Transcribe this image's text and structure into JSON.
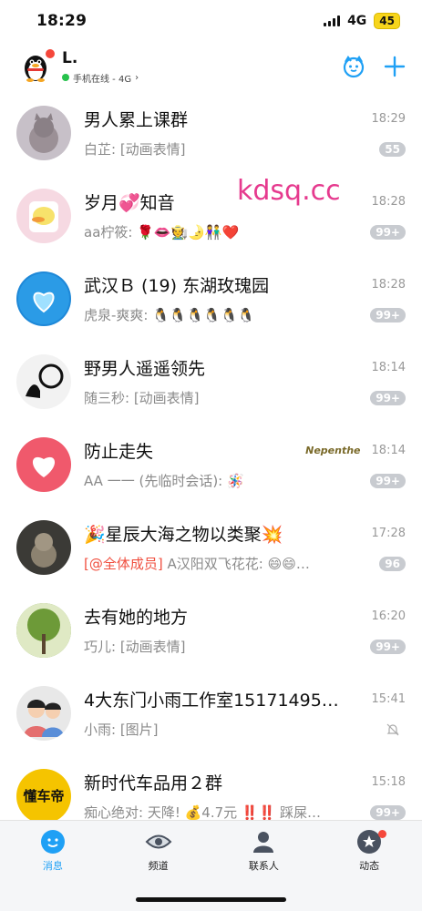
{
  "status_bar": {
    "time": "18:29",
    "network": "4G",
    "battery": "45"
  },
  "header": {
    "name": "L.",
    "status": "手机在线 - 4G",
    "status_chevron": "›"
  },
  "watermark": "kdsq.cc",
  "chats": [
    {
      "title": "男人累上课群",
      "time": "18:29",
      "preview": "白芷: [动画表情]",
      "badge": "55",
      "avatar_color": "#c7c0c8"
    },
    {
      "title": "岁月💞知音",
      "time": "18:28",
      "preview": "aa柠筱: 🌹👄🧑‍🌾🌛👫❤️",
      "badge": "99+",
      "avatar_color": "#f6d9e2"
    },
    {
      "title": "武汉Ｂ (19) 东湖玫瑰园",
      "time": "18:28",
      "preview": "虎泉-爽爽: 🐧🐧🐧🐧🐧🐧",
      "badge": "99+",
      "avatar_color": "#1e88d8"
    },
    {
      "title": "野男人遥遥领先",
      "time": "18:14",
      "preview": "随三秒: [动画表情]",
      "badge": "99+",
      "avatar_color": "#f2f2f2"
    },
    {
      "title": "防止走失",
      "time": "18:14",
      "preview": "AA 一一 (先临时会话): 🪅",
      "badge": "99+",
      "avatar_color": "#f0596c",
      "tag": "Nepenthe"
    },
    {
      "title": "🎉星辰大海之物以类聚💥",
      "time": "17:28",
      "mention": "[@全体成员]",
      "preview": " A汉阳双飞花花: 😄😄…",
      "badge": "96",
      "avatar_color": "#3b3a36"
    },
    {
      "title": "去有她的地方",
      "time": "16:20",
      "preview": "巧儿: [动画表情]",
      "badge": "99+",
      "avatar_color": "#7fa64a"
    },
    {
      "title": "4大东门小雨工作室15171495…",
      "time": "15:41",
      "preview": "小雨: [图片]",
      "badge": "",
      "muted": true,
      "avatar_color": "#e8e8e8"
    },
    {
      "title": "新时代车品用２群",
      "time": "15:18",
      "preview": "痴心绝对: 天降! 💰4.7元 ‼️‼️ 踩屎…",
      "badge": "99+",
      "avatar_color": "#f5c400",
      "avatar_text": "懂车帝"
    }
  ],
  "tabs": [
    {
      "label": "消息",
      "icon": "message-icon",
      "active": true
    },
    {
      "label": "频道",
      "icon": "channel-icon",
      "active": false
    },
    {
      "label": "联系人",
      "icon": "contacts-icon",
      "active": false
    },
    {
      "label": "动态",
      "icon": "feed-icon",
      "active": false,
      "dot": true
    }
  ],
  "colors": {
    "accent": "#1fa0f5",
    "badge": "#c8cbd0",
    "mention": "#f04f3f",
    "online": "#27c24c",
    "notify_dot": "#f5473b"
  }
}
